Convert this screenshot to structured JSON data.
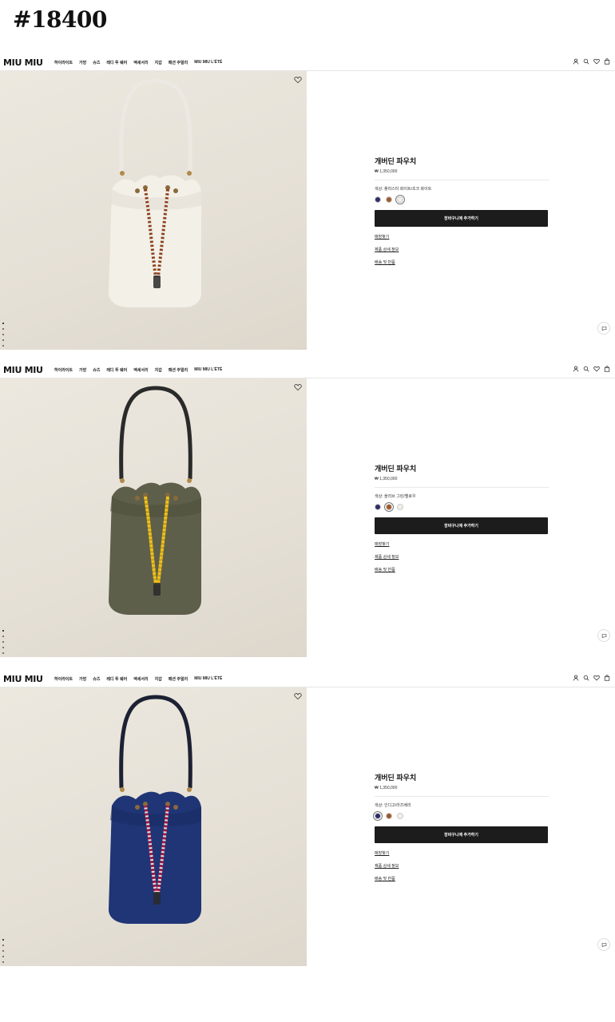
{
  "page_tag": "#18400",
  "header": {
    "logo": "MIU MIU",
    "menu": [
      "하이라이트",
      "가방",
      "슈즈",
      "레디 투 웨어",
      "액세서리",
      "지갑",
      "패션 주얼리",
      "MIU MIU L'ÉTÉ"
    ]
  },
  "icons": [
    "user-icon",
    "search-icon",
    "heart-icon",
    "bag-icon",
    "chat-icon"
  ],
  "products": [
    {
      "title": "개버딘 파우치",
      "price": "₩ 1,350,000",
      "color_line": "색상: 플라스터 화이트/초크 화이트",
      "swatches": [
        "#2c2f66",
        "#a0582a",
        "#f1eee6"
      ],
      "selected_swatch": 2,
      "cart_label": "장바구니에 추가하기",
      "links": [
        "매장찾기",
        "제품 상세 정보",
        "배송 및 반품"
      ],
      "bag_body": "#f3f0e8",
      "bag_shade": "#e2ddd1",
      "strap": "#ece9e2",
      "cord_a": "#8a3f1a",
      "cord_b": "#f0ece4"
    },
    {
      "title": "개버딘 파우치",
      "price": "₩ 1,350,000",
      "color_line": "색상: 올리브 그린/옐로우",
      "swatches": [
        "#2c2f66",
        "#a0582a",
        "#f1eee6"
      ],
      "selected_swatch": 1,
      "cart_label": "장바구니에 추가하기",
      "links": [
        "매장찾기",
        "제품 상세 정보",
        "배송 및 반품"
      ],
      "bag_body": "#5d5f4b",
      "bag_shade": "#4c4e3d",
      "strap": "#2a2a2a",
      "cord_a": "#f2c41c",
      "cord_b": "#e4b010"
    },
    {
      "title": "개버딘 파우치",
      "price": "₩ 1,350,000",
      "color_line": "색상: 인디고/라즈베리",
      "swatches": [
        "#2c2f66",
        "#a0582a",
        "#f1eee6"
      ],
      "selected_swatch": 0,
      "cart_label": "장바구니에 추가하기",
      "links": [
        "매장찾기",
        "제품 상세 정보",
        "배송 및 반품"
      ],
      "bag_body": "#1f3576",
      "bag_shade": "#172a60",
      "strap": "#1c2233",
      "cord_a": "#b0183c",
      "cord_b": "#f2d9df"
    }
  ]
}
